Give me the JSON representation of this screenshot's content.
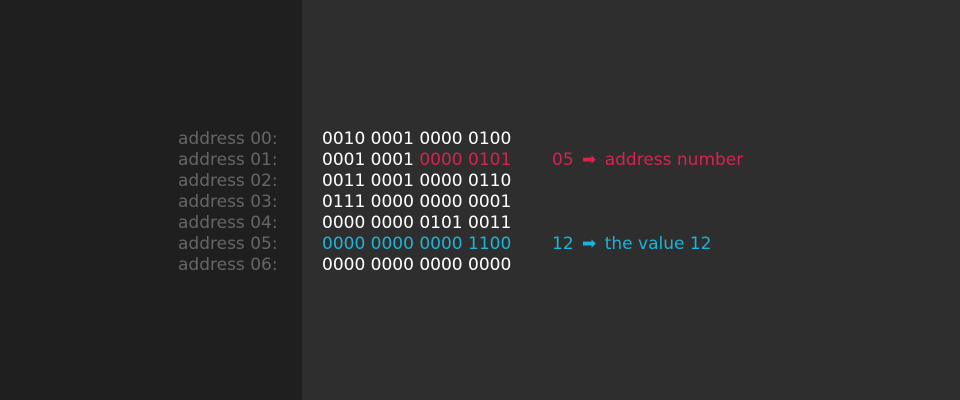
{
  "colors": {
    "highlight_red": "#d6244f",
    "highlight_blue": "#1cb4d9",
    "address_gray": "#666666",
    "left_panel": "#1f1f1f",
    "main_panel": "#2e2e2e"
  },
  "rows": [
    {
      "address": "address 00:",
      "bits": "0010 0001 0000 0100",
      "bits_plain": "0010 0001 0000 0100",
      "bits_highlight": "",
      "highlight": "none",
      "note": ""
    },
    {
      "address": "address 01:",
      "bits": "0001 0001 0000 0101",
      "bits_plain": "0001 0001 ",
      "bits_highlight": "0000 0101",
      "highlight": "red",
      "note": {
        "value": "05",
        "arrow": "➡",
        "text": "address number"
      }
    },
    {
      "address": "address 02:",
      "bits": "0011 0001 0000 0110",
      "bits_plain": "0011 0001 0000 0110",
      "bits_highlight": "",
      "highlight": "none",
      "note": ""
    },
    {
      "address": "address 03:",
      "bits": "0111 0000 0000 0001",
      "bits_plain": "0111 0000 0000 0001",
      "bits_highlight": "",
      "highlight": "none",
      "note": ""
    },
    {
      "address": "address 04:",
      "bits": "0000 0000 0101 0011",
      "bits_plain": "0000 0000 0101 0011",
      "bits_highlight": "",
      "highlight": "none",
      "note": ""
    },
    {
      "address": "address 05:",
      "bits": "0000 0000 0000 1100",
      "bits_plain": "",
      "bits_highlight": "0000 0000 0000 1100",
      "highlight": "blue",
      "note": {
        "value": "12",
        "arrow": "➡",
        "text": "the value 12"
      }
    },
    {
      "address": "address 06:",
      "bits": "0000 0000 0000 0000",
      "bits_plain": "0000 0000 0000 0000",
      "bits_highlight": "",
      "highlight": "none",
      "note": ""
    }
  ]
}
